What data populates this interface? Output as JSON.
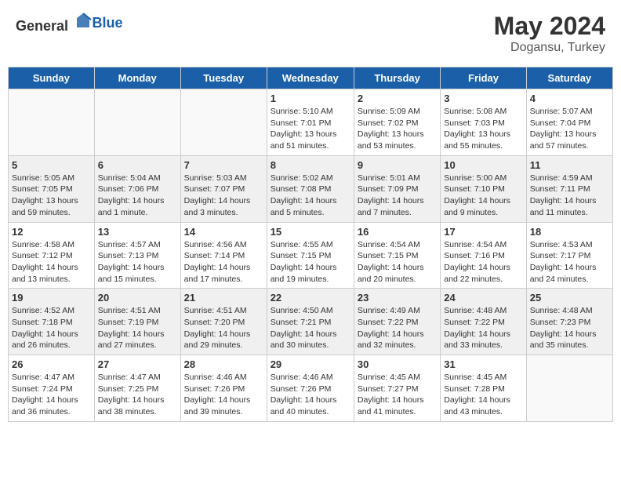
{
  "header": {
    "logo_general": "General",
    "logo_blue": "Blue",
    "month_year": "May 2024",
    "location": "Dogansu, Turkey"
  },
  "weekdays": [
    "Sunday",
    "Monday",
    "Tuesday",
    "Wednesday",
    "Thursday",
    "Friday",
    "Saturday"
  ],
  "weeks": [
    [
      {
        "day": "",
        "info": ""
      },
      {
        "day": "",
        "info": ""
      },
      {
        "day": "",
        "info": ""
      },
      {
        "day": "1",
        "info": "Sunrise: 5:10 AM\nSunset: 7:01 PM\nDaylight: 13 hours\nand 51 minutes."
      },
      {
        "day": "2",
        "info": "Sunrise: 5:09 AM\nSunset: 7:02 PM\nDaylight: 13 hours\nand 53 minutes."
      },
      {
        "day": "3",
        "info": "Sunrise: 5:08 AM\nSunset: 7:03 PM\nDaylight: 13 hours\nand 55 minutes."
      },
      {
        "day": "4",
        "info": "Sunrise: 5:07 AM\nSunset: 7:04 PM\nDaylight: 13 hours\nand 57 minutes."
      }
    ],
    [
      {
        "day": "5",
        "info": "Sunrise: 5:05 AM\nSunset: 7:05 PM\nDaylight: 13 hours\nand 59 minutes."
      },
      {
        "day": "6",
        "info": "Sunrise: 5:04 AM\nSunset: 7:06 PM\nDaylight: 14 hours\nand 1 minute."
      },
      {
        "day": "7",
        "info": "Sunrise: 5:03 AM\nSunset: 7:07 PM\nDaylight: 14 hours\nand 3 minutes."
      },
      {
        "day": "8",
        "info": "Sunrise: 5:02 AM\nSunset: 7:08 PM\nDaylight: 14 hours\nand 5 minutes."
      },
      {
        "day": "9",
        "info": "Sunrise: 5:01 AM\nSunset: 7:09 PM\nDaylight: 14 hours\nand 7 minutes."
      },
      {
        "day": "10",
        "info": "Sunrise: 5:00 AM\nSunset: 7:10 PM\nDaylight: 14 hours\nand 9 minutes."
      },
      {
        "day": "11",
        "info": "Sunrise: 4:59 AM\nSunset: 7:11 PM\nDaylight: 14 hours\nand 11 minutes."
      }
    ],
    [
      {
        "day": "12",
        "info": "Sunrise: 4:58 AM\nSunset: 7:12 PM\nDaylight: 14 hours\nand 13 minutes."
      },
      {
        "day": "13",
        "info": "Sunrise: 4:57 AM\nSunset: 7:13 PM\nDaylight: 14 hours\nand 15 minutes."
      },
      {
        "day": "14",
        "info": "Sunrise: 4:56 AM\nSunset: 7:14 PM\nDaylight: 14 hours\nand 17 minutes."
      },
      {
        "day": "15",
        "info": "Sunrise: 4:55 AM\nSunset: 7:15 PM\nDaylight: 14 hours\nand 19 minutes."
      },
      {
        "day": "16",
        "info": "Sunrise: 4:54 AM\nSunset: 7:15 PM\nDaylight: 14 hours\nand 20 minutes."
      },
      {
        "day": "17",
        "info": "Sunrise: 4:54 AM\nSunset: 7:16 PM\nDaylight: 14 hours\nand 22 minutes."
      },
      {
        "day": "18",
        "info": "Sunrise: 4:53 AM\nSunset: 7:17 PM\nDaylight: 14 hours\nand 24 minutes."
      }
    ],
    [
      {
        "day": "19",
        "info": "Sunrise: 4:52 AM\nSunset: 7:18 PM\nDaylight: 14 hours\nand 26 minutes."
      },
      {
        "day": "20",
        "info": "Sunrise: 4:51 AM\nSunset: 7:19 PM\nDaylight: 14 hours\nand 27 minutes."
      },
      {
        "day": "21",
        "info": "Sunrise: 4:51 AM\nSunset: 7:20 PM\nDaylight: 14 hours\nand 29 minutes."
      },
      {
        "day": "22",
        "info": "Sunrise: 4:50 AM\nSunset: 7:21 PM\nDaylight: 14 hours\nand 30 minutes."
      },
      {
        "day": "23",
        "info": "Sunrise: 4:49 AM\nSunset: 7:22 PM\nDaylight: 14 hours\nand 32 minutes."
      },
      {
        "day": "24",
        "info": "Sunrise: 4:48 AM\nSunset: 7:22 PM\nDaylight: 14 hours\nand 33 minutes."
      },
      {
        "day": "25",
        "info": "Sunrise: 4:48 AM\nSunset: 7:23 PM\nDaylight: 14 hours\nand 35 minutes."
      }
    ],
    [
      {
        "day": "26",
        "info": "Sunrise: 4:47 AM\nSunset: 7:24 PM\nDaylight: 14 hours\nand 36 minutes."
      },
      {
        "day": "27",
        "info": "Sunrise: 4:47 AM\nSunset: 7:25 PM\nDaylight: 14 hours\nand 38 minutes."
      },
      {
        "day": "28",
        "info": "Sunrise: 4:46 AM\nSunset: 7:26 PM\nDaylight: 14 hours\nand 39 minutes."
      },
      {
        "day": "29",
        "info": "Sunrise: 4:46 AM\nSunset: 7:26 PM\nDaylight: 14 hours\nand 40 minutes."
      },
      {
        "day": "30",
        "info": "Sunrise: 4:45 AM\nSunset: 7:27 PM\nDaylight: 14 hours\nand 41 minutes."
      },
      {
        "day": "31",
        "info": "Sunrise: 4:45 AM\nSunset: 7:28 PM\nDaylight: 14 hours\nand 43 minutes."
      },
      {
        "day": "",
        "info": ""
      }
    ]
  ]
}
